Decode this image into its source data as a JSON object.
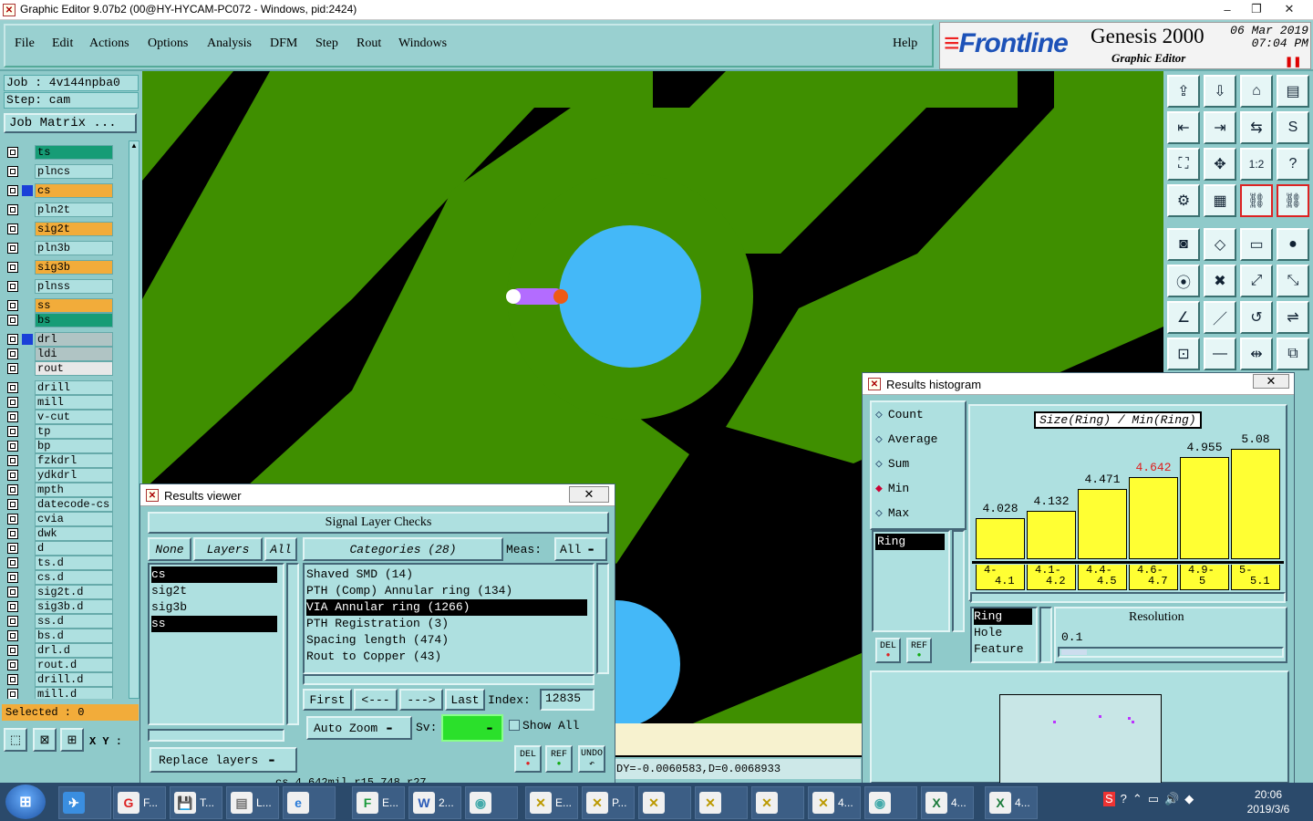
{
  "titlebar": {
    "title": "Graphic Editor 9.07b2 (00@HY-HYCAM-PC072 - Windows, pid:2424)",
    "minimize": "–",
    "restore": "❐",
    "close": "✕"
  },
  "menu": [
    "File",
    "Edit",
    "Actions",
    "Options",
    "Analysis",
    "DFM",
    "Step",
    "Rout",
    "Windows"
  ],
  "help": "Help",
  "logo": {
    "brand": "Frontline",
    "product": "Genesis 2000",
    "subtitle": "Graphic Editor",
    "date": "06 Mar 2019",
    "time": "07:04 PM"
  },
  "job": {
    "job_label": "Job : 4v144npba0",
    "step_label": "Step: cam",
    "job_matrix": "Job Matrix ..."
  },
  "layers": [
    {
      "name": "ts",
      "color": "#169c76"
    },
    {
      "name": "plncs",
      "color": "#aee0e0"
    },
    {
      "name": "cs",
      "color": "#f2ac3a",
      "active": true
    },
    {
      "name": "pln2t",
      "color": "#aee0e0"
    },
    {
      "name": "sig2t",
      "color": "#f2ac3a"
    },
    {
      "name": "pln3b",
      "color": "#aee0e0"
    },
    {
      "name": "sig3b",
      "color": "#f2ac3a"
    },
    {
      "name": "plnss",
      "color": "#aee0e0"
    },
    {
      "name": "ss",
      "color": "#f2ac3a"
    },
    {
      "name": "bs",
      "color": "#169c76"
    },
    {
      "name": "drl",
      "color": "#b0c4c4",
      "swatch": "#1a3fd8"
    },
    {
      "name": "ldi",
      "color": "#b0c4c4"
    },
    {
      "name": "rout",
      "color": "#e8e8e8"
    },
    {
      "name": "drill",
      "color": "#aee0e0"
    },
    {
      "name": "mill",
      "color": "#aee0e0"
    },
    {
      "name": "v-cut",
      "color": "#aee0e0"
    },
    {
      "name": "tp",
      "color": "#aee0e0"
    },
    {
      "name": "bp",
      "color": "#aee0e0"
    },
    {
      "name": "fzkdrl",
      "color": "#aee0e0"
    },
    {
      "name": "ydkdrl",
      "color": "#aee0e0"
    },
    {
      "name": "mpth",
      "color": "#aee0e0"
    },
    {
      "name": "datecode-cs",
      "color": "#aee0e0"
    },
    {
      "name": "cvia",
      "color": "#aee0e0"
    },
    {
      "name": "dwk",
      "color": "#aee0e0"
    },
    {
      "name": "d",
      "color": "#aee0e0"
    },
    {
      "name": "ts.d",
      "color": "#aee0e0"
    },
    {
      "name": "cs.d",
      "color": "#aee0e0"
    },
    {
      "name": "sig2t.d",
      "color": "#aee0e0"
    },
    {
      "name": "sig3b.d",
      "color": "#aee0e0"
    },
    {
      "name": "ss.d",
      "color": "#aee0e0"
    },
    {
      "name": "bs.d",
      "color": "#aee0e0"
    },
    {
      "name": "drl.d",
      "color": "#aee0e0"
    },
    {
      "name": "rout.d",
      "color": "#aee0e0"
    },
    {
      "name": "drill.d",
      "color": "#aee0e0"
    },
    {
      "name": "mill.d",
      "color": "#aee0e0"
    }
  ],
  "selected": "Selected : 0",
  "xy_label": "X Y :",
  "coords": "DY=-0.0060583,D=0.0068933",
  "status_line": "cs 4.642mil r15.748 r27",
  "results_viewer": {
    "title": "Results viewer",
    "close": "✕",
    "header": "Signal Layer Checks",
    "none_btn": "None",
    "layers_label": "Layers",
    "all_btn": "All",
    "categories_label": "Categories (28)",
    "meas_label": "Meas:",
    "meas_value": "All",
    "layer_items": [
      {
        "name": "cs",
        "sel": true
      },
      {
        "name": "sig2t",
        "sel": false
      },
      {
        "name": "sig3b",
        "sel": false
      },
      {
        "name": "ss",
        "sel": true
      }
    ],
    "categories": [
      {
        "name": "Shaved SMD (14)",
        "sel": false
      },
      {
        "name": "PTH (Comp) Annular ring (134)",
        "sel": false
      },
      {
        "name": "VIA Annular ring (1266)",
        "sel": true
      },
      {
        "name": "PTH Registration (3)",
        "sel": false
      },
      {
        "name": "Spacing length (474)",
        "sel": false
      },
      {
        "name": "Rout to Copper (43)",
        "sel": false
      }
    ],
    "first_btn": "First",
    "prev_btn": "<---",
    "next_btn": "--->",
    "last_btn": "Last",
    "index_label": "Index:",
    "index_value": "12835",
    "zoom_value": "Auto Zoom",
    "sv_label": "Sv:",
    "show_all": "Show All",
    "replace_layers": "Replace layers",
    "del": "DEL",
    "ref": "REF",
    "undo": "UNDO"
  },
  "histogram": {
    "title": "Results histogram",
    "close": "✕",
    "chart_title": "Size(Ring) / Min(Ring)",
    "modes": [
      {
        "name": "Count",
        "sel": false
      },
      {
        "name": "Average",
        "sel": false
      },
      {
        "name": "Sum",
        "sel": false
      },
      {
        "name": "Min",
        "sel": true
      },
      {
        "name": "Max",
        "sel": false
      }
    ],
    "list_item": "Ring",
    "del": "DEL",
    "ref": "REF",
    "attr_items": [
      {
        "name": "Ring",
        "sel": true
      },
      {
        "name": "Hole",
        "sel": false
      },
      {
        "name": "Feature",
        "sel": false
      }
    ],
    "resolution_label": "Resolution",
    "resolution_value": "0.1"
  },
  "chart_data": {
    "type": "bar",
    "title": "Size(Ring) / Min(Ring)",
    "categories": [
      "4-4.1",
      "4.1-4.2",
      "4.4-4.5",
      "4.6-4.7",
      "4.9-5",
      "5-5.1"
    ],
    "category_lines": [
      [
        "4-",
        "4.1"
      ],
      [
        "4.1-",
        "4.2"
      ],
      [
        "4.4-",
        "4.5"
      ],
      [
        "4.6-",
        "4.7"
      ],
      [
        "4.9-",
        "5"
      ],
      [
        "5-",
        "5.1"
      ]
    ],
    "values": [
      4.028,
      4.132,
      4.471,
      4.642,
      4.955,
      5.08
    ],
    "value_labels": [
      "4.028",
      "4.132",
      "4.471",
      "4.642",
      "4.955",
      "5.08"
    ],
    "highlight_index": 3,
    "highlight_color": "#e01b1b",
    "bar_color": "#ffff33",
    "ylim": [
      3.4,
      5.2
    ]
  },
  "taskbar": {
    "items": [
      {
        "label": "F...",
        "icon": "G",
        "color": "#d22"
      },
      {
        "label": "T...",
        "icon": "💾",
        "color": "#35a"
      },
      {
        "label": "L...",
        "icon": "▤",
        "color": "#777"
      },
      {
        "label": "",
        "icon": "e",
        "color": "#2a7bd8"
      },
      {
        "label": "E...",
        "icon": "F",
        "color": "#1a9a3a"
      },
      {
        "label": "2...",
        "icon": "W",
        "color": "#2a5bb8"
      },
      {
        "label": "",
        "icon": "◉",
        "color": "#4aa"
      },
      {
        "label": "E...",
        "icon": "✕",
        "color": "#b90"
      },
      {
        "label": "P...",
        "icon": "✕",
        "color": "#b90"
      },
      {
        "label": "",
        "icon": "✕",
        "color": "#b90"
      },
      {
        "label": "",
        "icon": "✕",
        "color": "#b90"
      },
      {
        "label": "",
        "icon": "✕",
        "color": "#b90"
      },
      {
        "label": "4...",
        "icon": "✕",
        "color": "#b90"
      },
      {
        "label": "",
        "icon": "◉",
        "color": "#4aa"
      },
      {
        "label": "4...",
        "icon": "X",
        "color": "#1a7a3a"
      },
      {
        "label": "4...",
        "icon": "X",
        "color": "#1a7a3a"
      }
    ],
    "clock_time": "20:06",
    "clock_date": "2019/3/6"
  }
}
